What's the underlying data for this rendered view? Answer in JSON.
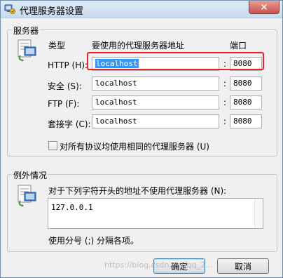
{
  "window": {
    "title": "代理服务器设置",
    "close_label": "×"
  },
  "servers_group": {
    "legend": "服务器",
    "col_type": "类型",
    "col_address": "要使用的代理服务器地址",
    "col_port": "端口",
    "rows": [
      {
        "type_label": "HTTP (H):",
        "address": "localhost",
        "port": "8080"
      },
      {
        "type_label": "安全 (S):",
        "address": "localhost",
        "port": "8080"
      },
      {
        "type_label": "FTP (F):",
        "address": "localhost",
        "port": "8080"
      },
      {
        "type_label": "套接字 (C):",
        "address": "localhost",
        "port": "8080"
      }
    ],
    "colon": ":",
    "same_proxy_label": "对所有协议均使用相同的代理服务器 (U)"
  },
  "exceptions_group": {
    "legend": "例外情况",
    "description": "对于下列字符开头的地址不使用代理服务器 (N):",
    "value": "127.0.0.1",
    "hint": "使用分号 (;) 分隔各项。"
  },
  "buttons": {
    "ok": "确定",
    "cancel": "取消"
  },
  "watermark": "https://blog.csdn.net/qq_2...",
  "colors": {
    "highlight": "#e8202a",
    "selection": "#3399ff"
  }
}
